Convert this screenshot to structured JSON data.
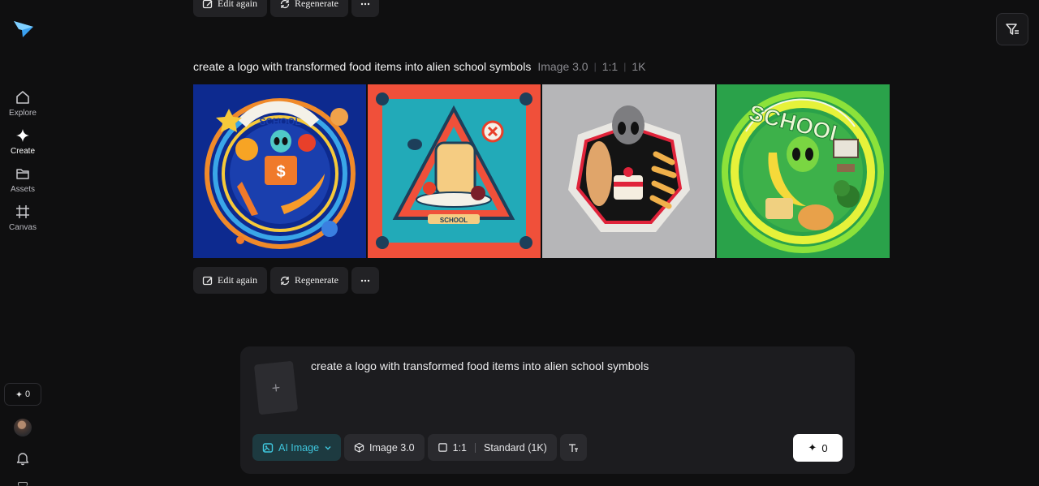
{
  "sidebar": {
    "items": [
      {
        "label": "Explore",
        "icon": "home-icon",
        "active": false
      },
      {
        "label": "Create",
        "icon": "sparkle-icon",
        "active": true
      },
      {
        "label": "Assets",
        "icon": "folder-icon",
        "active": false
      },
      {
        "label": "Canvas",
        "icon": "frame-icon",
        "active": false
      }
    ],
    "credits": "0"
  },
  "top_actions": {
    "edit_label": "Edit again",
    "regenerate_label": "Regenerate"
  },
  "generation": {
    "prompt": "create a logo with transformed food items into alien school symbols",
    "model": "Image 3.0",
    "ratio": "1:1",
    "resolution": "1K",
    "images": [
      {
        "text": "SCHOOL",
        "style": "blue circular badge with alien and fruits"
      },
      {
        "text": "SCHOOL",
        "style": "red square frame with toast character"
      },
      {
        "text": "",
        "style": "gray background alien with cake shield"
      },
      {
        "text": "SCHOOL",
        "style": "green ring with alien and food"
      }
    ],
    "edit_label": "Edit again",
    "regenerate_label": "Regenerate"
  },
  "composer": {
    "prompt_text": "create a logo with transformed food items into alien school symbols",
    "mode_label": "AI Image",
    "model_label": "Image 3.0",
    "ratio_label": "1:1",
    "quality_label": "Standard (1K)",
    "generate_cost": "0"
  },
  "colors": {
    "background": "#0f0f10",
    "panel": "#1c1c1f",
    "accent": "#3fc6dd",
    "logo": "#3aa0f0"
  }
}
